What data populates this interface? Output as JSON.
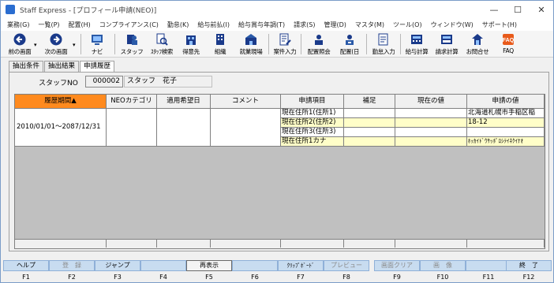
{
  "window": {
    "title": "Staff Express - [プロフィール申請(NEO)]",
    "controls": [
      "—",
      "☐",
      "✕"
    ]
  },
  "menu": [
    "業務(G)",
    "一覧(P)",
    "配置(H)",
    "コンプライアンス(C)",
    "勤怠(K)",
    "給与前払(I)",
    "給与賞与年調(T)",
    "請求(S)",
    "管理(D)",
    "マスタ(M)",
    "ツール(O)",
    "ウィンドウ(W)",
    "サポート(H)"
  ],
  "toolbar": [
    {
      "label": "前の画面",
      "icon": "back-arrow-icon"
    },
    {
      "label": "次の画面",
      "icon": "forward-arrow-icon"
    },
    {
      "label": "ナビ",
      "icon": "navi-icon"
    },
    {
      "label": "スタッフ",
      "icon": "staff-icon"
    },
    {
      "label": "ｽﾀｯﾌ検索",
      "icon": "staff-search-icon"
    },
    {
      "label": "得意先",
      "icon": "client-icon"
    },
    {
      "label": "組織",
      "icon": "organization-icon"
    },
    {
      "label": "就業現場",
      "icon": "worksite-icon"
    },
    {
      "label": "案件入力",
      "icon": "job-entry-icon"
    },
    {
      "label": "配置照会",
      "icon": "placement-inquiry-icon"
    },
    {
      "label": "配置(日",
      "icon": "placement-daily-icon"
    },
    {
      "label": "勤怠入力",
      "icon": "attendance-entry-icon"
    },
    {
      "label": "給与計算",
      "icon": "payroll-icon"
    },
    {
      "label": "請求計算",
      "icon": "billing-icon"
    },
    {
      "label": "お問合せ",
      "icon": "inquiry-icon"
    },
    {
      "label": "FAQ",
      "icon": "faq-icon"
    }
  ],
  "tabs": [
    "抽出条件",
    "抽出結果",
    "申請履歴"
  ],
  "active_tab": "申請履歴",
  "staff": {
    "label": "スタッフNO",
    "no": "000002",
    "name": "スタッフ　花子"
  },
  "grid": {
    "headers": [
      "履歴期間▲",
      "NEOカテゴリ",
      "適用希望日",
      "コメント",
      "申請項目",
      "補足",
      "現在の値",
      "申請の値"
    ],
    "period": "2010/01/01～2087/12/31",
    "rows": [
      {
        "item": "現在住所1(住所1)",
        "note": "",
        "current": "",
        "requested": "北海道札幌市手稲区稲"
      },
      {
        "item": "現在住所2(住所2)",
        "note": "",
        "current": "",
        "requested": "18-12"
      },
      {
        "item": "現在住所3(住所3)",
        "note": "",
        "current": "",
        "requested": ""
      },
      {
        "item": "現在住所1カナ",
        "note": "",
        "current": "",
        "requested": "ﾎｯｶｲﾄﾞｳｻｯﾎﾟﾛｼﾃｲﾈｸｲﾅｵ"
      }
    ]
  },
  "fkeys": [
    {
      "label": "ヘルプ",
      "key": "F1",
      "enabled": true
    },
    {
      "label": "登　録",
      "key": "F2",
      "enabled": false
    },
    {
      "label": "ジャンプ",
      "key": "F3",
      "enabled": true
    },
    {
      "label": "",
      "key": "F4",
      "enabled": true
    },
    {
      "label": "再表示",
      "key": "F5",
      "enabled": true
    },
    {
      "label": "",
      "key": "F6",
      "enabled": true
    },
    {
      "label": "ｸﾘｯﾌﾟﾎﾞｰﾄﾞ",
      "key": "F7",
      "enabled": true
    },
    {
      "label": "プレビュー",
      "key": "F8",
      "enabled": false
    },
    {
      "label": "画面クリア",
      "key": "F9",
      "enabled": false
    },
    {
      "label": "画　像",
      "key": "F10",
      "enabled": false
    },
    {
      "label": "",
      "key": "F11",
      "enabled": true
    },
    {
      "label": "終　了",
      "key": "F12",
      "enabled": true
    }
  ],
  "colors": {
    "sorted_header": "#ff8a1e",
    "requested_row": "#fffec8",
    "fkey": "#c8dcf0"
  }
}
